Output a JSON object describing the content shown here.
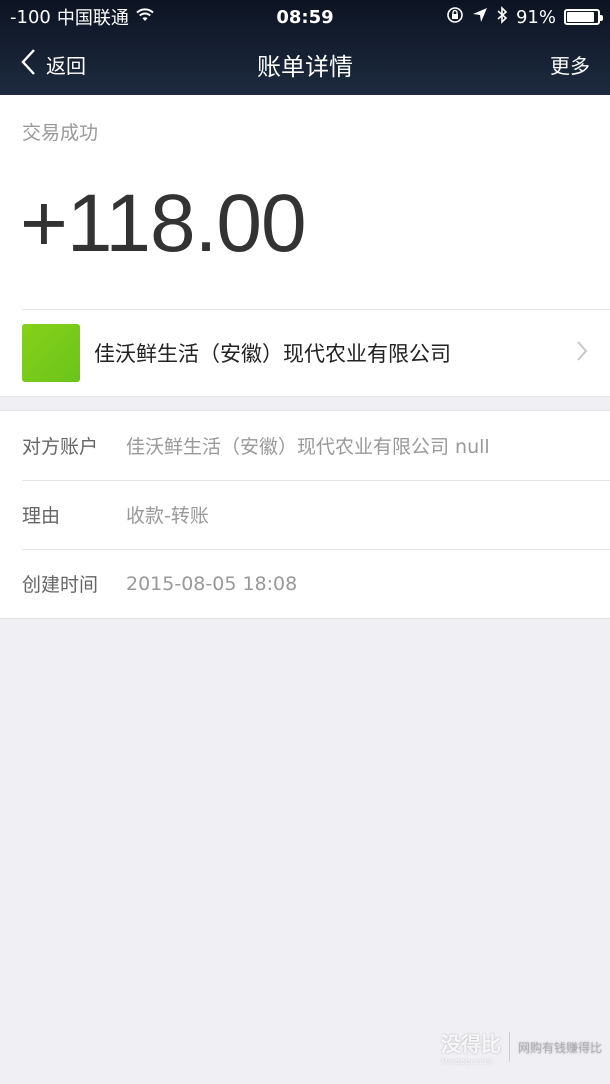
{
  "status_bar": {
    "signal": "-100",
    "carrier": "中国联通",
    "time": "08:59",
    "battery": "91%",
    "battery_level": 0.91
  },
  "nav": {
    "back_label": "返回",
    "title": "账单详情",
    "more_label": "更多"
  },
  "transaction": {
    "status": "交易成功",
    "amount": "+118.00"
  },
  "merchant": {
    "name": "佳沃鲜生活（安徽）现代农业有限公司",
    "logo_color": "#7ccc1b"
  },
  "details": [
    {
      "label": "对方账户",
      "value": "佳沃鲜生活（安徽）现代农业有限公司 null"
    },
    {
      "label": "理由",
      "value": "收款-转账"
    },
    {
      "label": "创建时间",
      "value": "2015-08-05 18:08"
    }
  ],
  "watermark": {
    "brand": "没得比",
    "domain": "Meidebi.com",
    "slogan": "网购有钱赚得比"
  }
}
